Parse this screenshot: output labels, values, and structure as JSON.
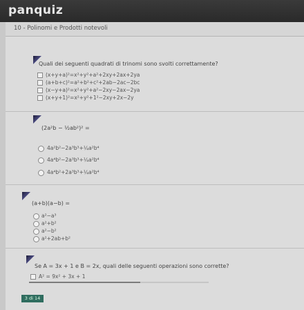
{
  "app": {
    "title": "panquiz"
  },
  "breadcrumb": "10 - Polinomi e Prodotti notevoli",
  "questions": [
    {
      "text": "Quali dei seguenti quadrati di trinomi sono svolti correttamente?",
      "type": "checkbox",
      "options": [
        "(x+y+a)²=x²+y²+a²+2xy+2ax+2ya",
        "(a+b+c)²=a²+b²+c²+2ab−2ac−2bc",
        "(x−y+a)²=x²+y²+a²−2xy−2ax−2ya",
        "(x+y+1)²=x²+y²+1²−2xy+2x−2y"
      ]
    },
    {
      "text": "(2a²b − ½ab²)² =",
      "type": "radio",
      "options": [
        "4a²b²−2a³b³+¼a²b⁴",
        "4a⁴b²−2a³b³+¼a²b⁴",
        "4a⁴b²+2a³b³+¼a²b⁴"
      ]
    },
    {
      "text": "(a+b)(a−b) =",
      "type": "radio",
      "options": [
        "a²−a³",
        "a²+b²",
        "a²−b²",
        "a²+2ab+b²"
      ]
    },
    {
      "text": "Se A = 3x + 1 e B = 2x, quali delle seguenti operazioni sono corrette?",
      "type": "checkbox",
      "options": [
        "A² = 9x² + 3x + 1"
      ]
    }
  ],
  "progress": {
    "value_percent": 62
  },
  "footer_chip": "3 di 14"
}
